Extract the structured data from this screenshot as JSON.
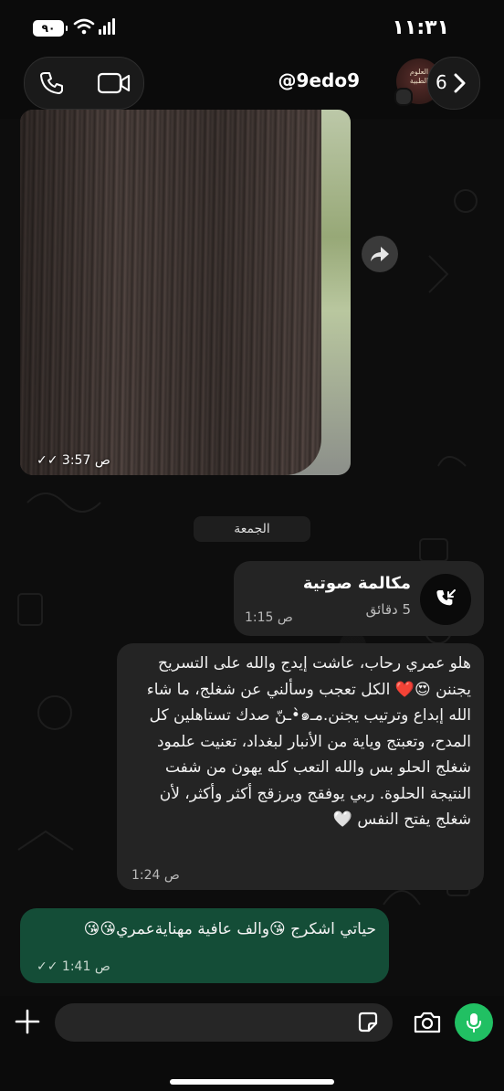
{
  "status_bar": {
    "time": "١١:٣١",
    "battery": "٩٠"
  },
  "header": {
    "contact_handle": "@9edo9",
    "back_count": "6",
    "avatar_text": "العلوم الطبية"
  },
  "photo_message": {
    "time": "3:57 ص"
  },
  "date_separator": "الجمعة",
  "call_message": {
    "title": "مكالمة صوتية",
    "duration": "5 دقائق",
    "time": "1:15 ص"
  },
  "received_message": {
    "text": "هلو عمري رحاب، عاشت إيدج والله على التسريح يجننن 😍❤️ الكل تعجب وسألني عن شغلج، ما شاء الله إبداع وترتيب يجنن.مـ๑•̀ـنّ صدك تستاهلين كل المدح، وتعبتج وياية من الأنبار لبغداد، تعنيت علمود شغلج الحلو بس والله التعب كله يهون من شفت النتيجة الحلوة. ربي يوفقج ويرزقج أكثر وأكثر، لأن شغلج يفتح النفس 🤍",
    "time": "1:24 ص"
  },
  "sent_message": {
    "text": "حياتي اشكرج 😘والف عافية مهنايةعمري😘😘",
    "time": "1:41 ص"
  },
  "colors": {
    "sent_bubble": "#144d37",
    "received_bubble": "#242424",
    "mic_button": "#21c063"
  }
}
